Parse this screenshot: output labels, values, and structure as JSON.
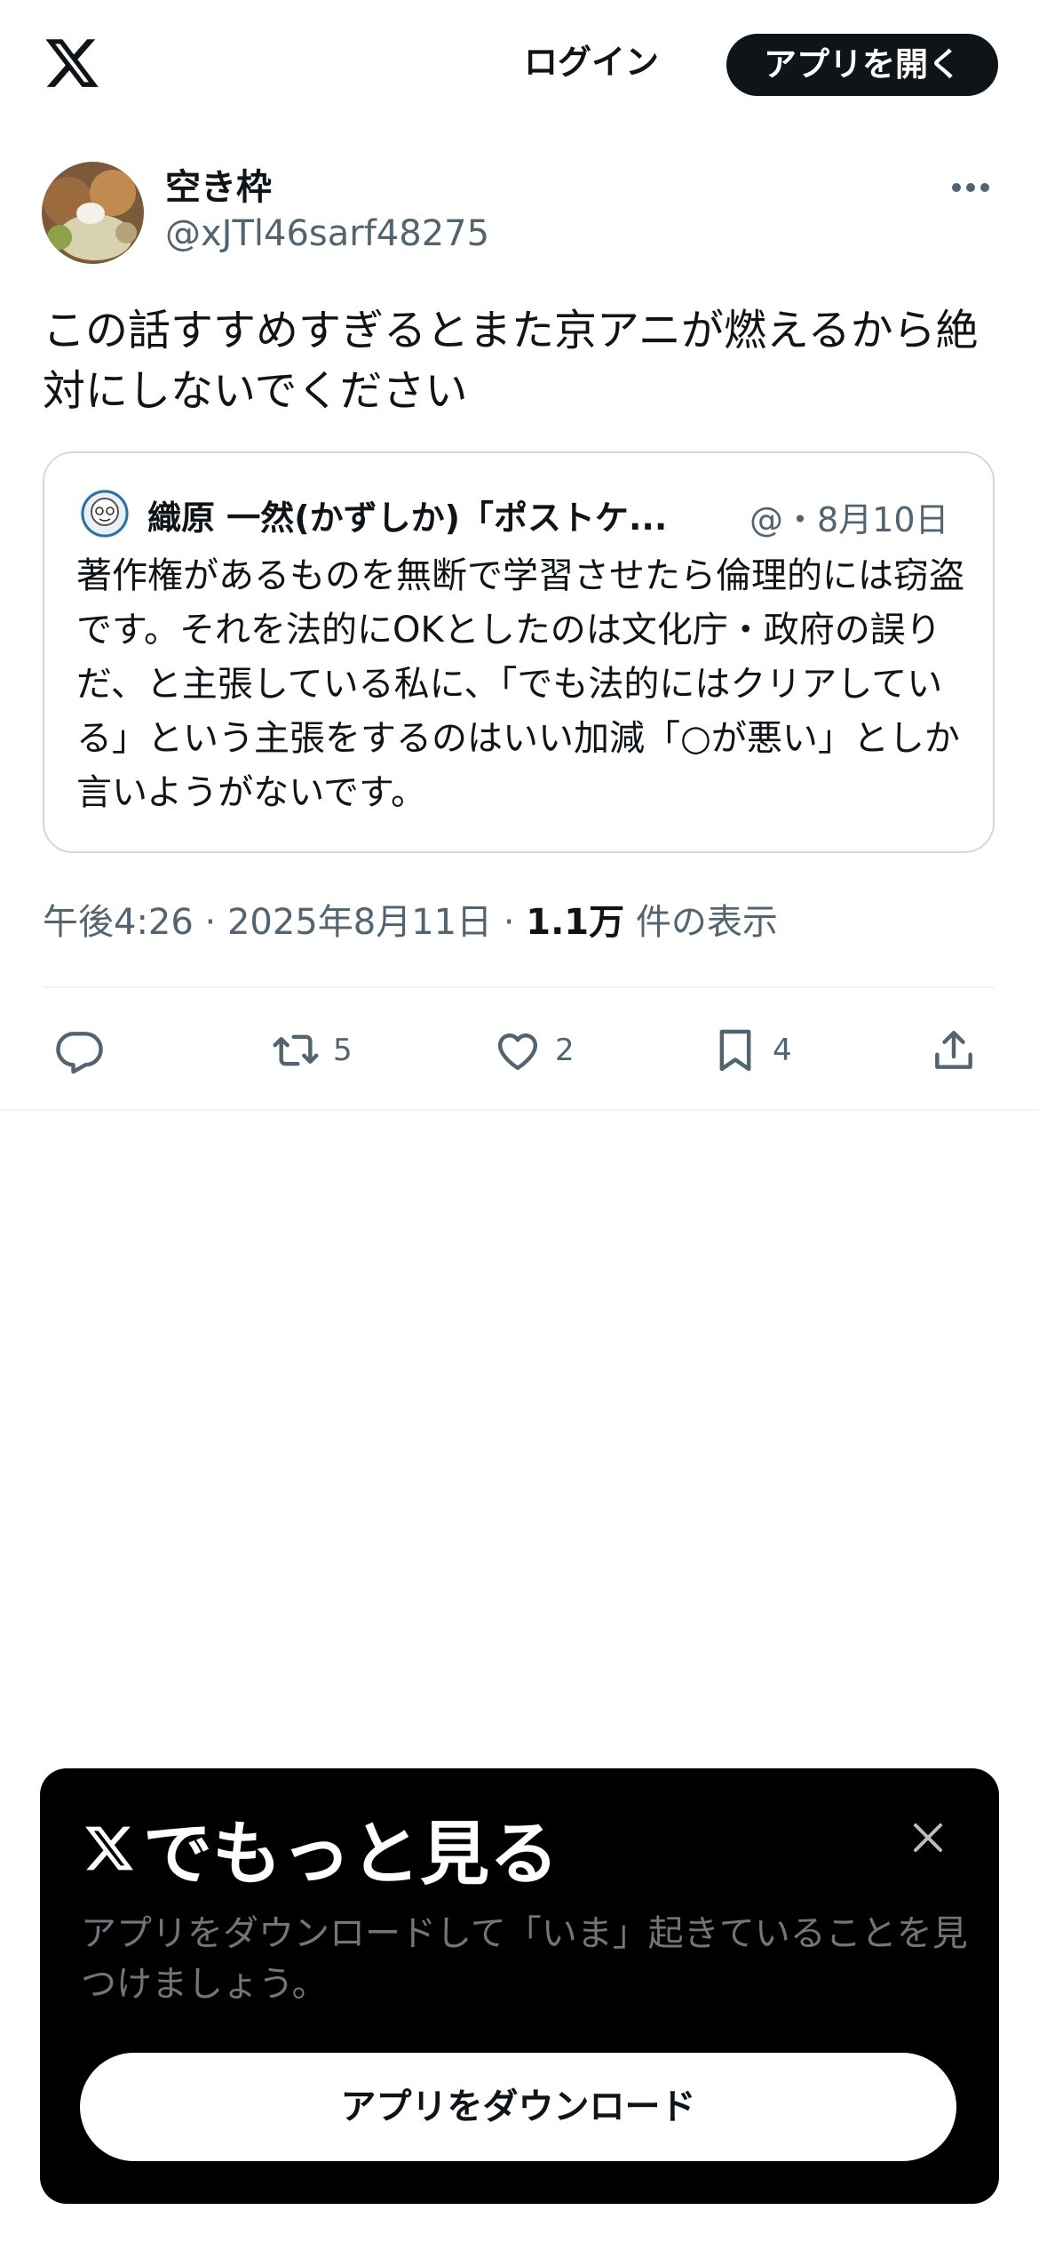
{
  "header": {
    "logo_icon": "x-logo-icon",
    "login_label": "ログイン",
    "open_app_label": "アプリを開く"
  },
  "post": {
    "display_name": "空き枠",
    "handle": "@xJTl46sarf48275",
    "more_icon": "more-horizontal-icon",
    "text": "この話すすめすぎるとまた京アニが燃えるから絶対にしないでください",
    "quote": {
      "name": "織原 一然(かずしか)「ポストケ...",
      "meta": "@・8月10日",
      "text": "著作権があるものを無断で学習させたら倫理的には窃盗です。それを法的にOKとしたのは文化庁・政府の誤りだ、と主張している私に、「でも法的にはクリアしている」という主張をするのはいい加減「○が悪い」としか言いようがないです。"
    },
    "timestamp": "午後4:26 · 2025年8月11日 · ",
    "views_count": "1.1万",
    "views_label": " 件の表示"
  },
  "actions": {
    "reply_icon": "reply-icon",
    "retweet_icon": "retweet-icon",
    "retweet_count": "5",
    "like_icon": "heart-icon",
    "like_count": "2",
    "bookmark_icon": "bookmark-icon",
    "bookmark_count": "4",
    "share_icon": "share-icon"
  },
  "sheet": {
    "title": "でもっと見る",
    "description": "アプリをダウンロードして「いま」起きていることを見つけましょう。",
    "download_label": "アプリをダウンロード",
    "close_icon": "close-icon"
  },
  "colors": {
    "text_primary": "#0f1419",
    "text_secondary": "#536471",
    "border": "#cfd9de",
    "sheet_bg": "#000000",
    "sheet_desc": "#71767b"
  }
}
